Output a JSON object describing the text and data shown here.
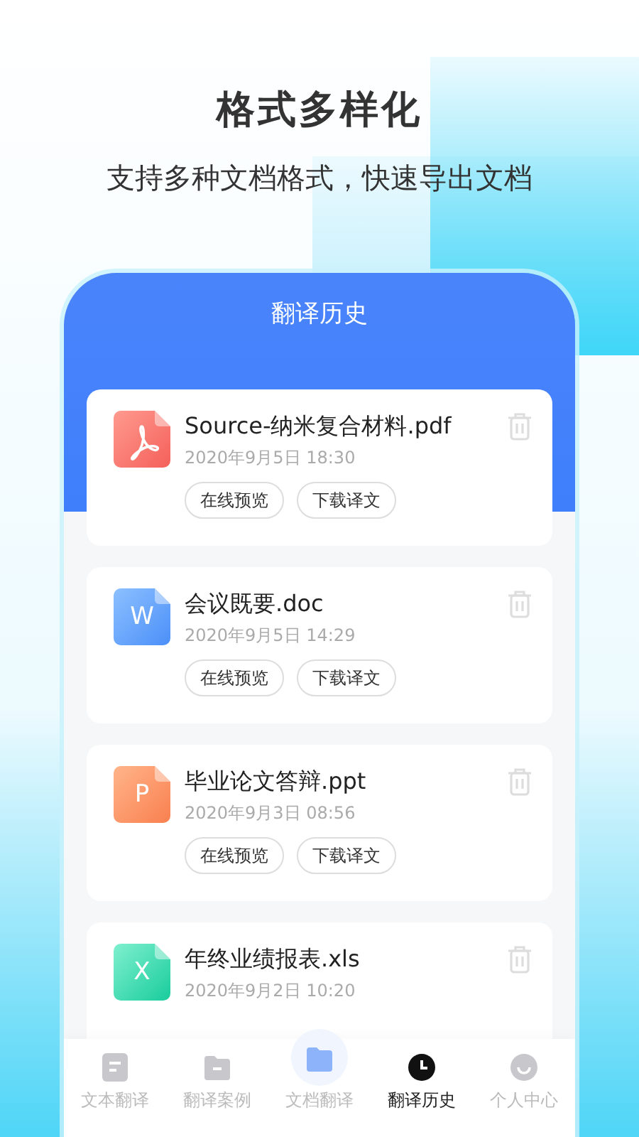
{
  "promo": {
    "title": "格式多样化",
    "subtitle": "支持多种文档格式，快速导出文档"
  },
  "screen": {
    "title": "翻译历史",
    "files": [
      {
        "kind": "pdf",
        "name": "Source-纳米复合材料.pdf",
        "date": "2020年9月5日 18:30",
        "buttons": [
          "在线预览",
          "下载译文"
        ]
      },
      {
        "kind": "word",
        "letter": "W",
        "name": "会议既要.doc",
        "date": "2020年9月5日 14:29",
        "buttons": [
          "在线预览",
          "下载译文"
        ]
      },
      {
        "kind": "ppt",
        "letter": "P",
        "name": "毕业论文答辩.ppt",
        "date": "2020年9月3日 08:56",
        "buttons": [
          "在线预览",
          "下载译文"
        ]
      },
      {
        "kind": "excel",
        "letter": "X",
        "name": "年终业绩报表.xls",
        "date": "2020年9月2日 10:20"
      }
    ]
  },
  "tab_bar": [
    {
      "kind": "text",
      "label": "文本翻译",
      "selected": false
    },
    {
      "kind": "case",
      "label": "翻译案例",
      "selected": false
    },
    {
      "kind": "document",
      "label": "文档翻译",
      "selected": false
    },
    {
      "kind": "history",
      "label": "翻译历史",
      "selected": true
    },
    {
      "kind": "profile",
      "label": "个人中心",
      "selected": false
    }
  ]
}
